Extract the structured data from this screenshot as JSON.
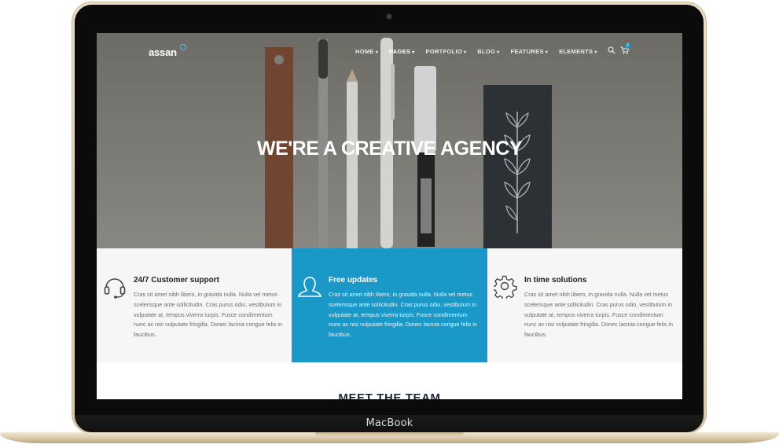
{
  "device": {
    "label": "MacBook"
  },
  "site": {
    "logo": "assan",
    "nav": [
      {
        "label": "HOME",
        "active": false
      },
      {
        "label": "PAGES",
        "active": true
      },
      {
        "label": "PORTFOLIO",
        "active": false
      },
      {
        "label": "BLOG",
        "active": false
      },
      {
        "label": "FEATURES",
        "active": false
      },
      {
        "label": "ELEMENTS",
        "active": false
      }
    ],
    "cart_count": "2",
    "hero_title": "WE'RE A CREATIVE AGENCY",
    "features": [
      {
        "icon": "headset-icon",
        "title": "24/7 Customer support",
        "text": "Cras sit amet nibh libero, in gravida nulla. Nulla vel metus scelerisque ante sollicitudin. Cras purus odio, vestibulum in vulputate at, tempus viverra turpis. Fusce condimentum nunc ac nisi vulputate fringilla. Donec lacinia congue felis in faucibus."
      },
      {
        "icon": "user-icon",
        "title": "Free updates",
        "text": "Cras sit amet nibh libero, in gravida nulla. Nulla vel metus scelerisque ante sollicitudin. Cras purus odio, vestibulum in vulputate at, tempus viverra turpis. Fusce condimentum nunc ac nisi vulputate fringilla. Donec lacinia congue felis in faucibus."
      },
      {
        "icon": "gear-icon",
        "title": "In time solutions",
        "text": "Cras sit amet nibh libero, in gravida nulla. Nulla vel metus scelerisque ante sollicitudin. Cras purus odio, vestibulum in vulputate at, tempus viverra turpis. Fusce condimentum nunc ac nisi vulputate fringilla. Donec lacinia congue felis in faucibus."
      }
    ],
    "section_heading": "MEET THE TEAM",
    "colors": {
      "accent": "#1a98c7",
      "feature_bg": "#f6f6f6"
    }
  }
}
